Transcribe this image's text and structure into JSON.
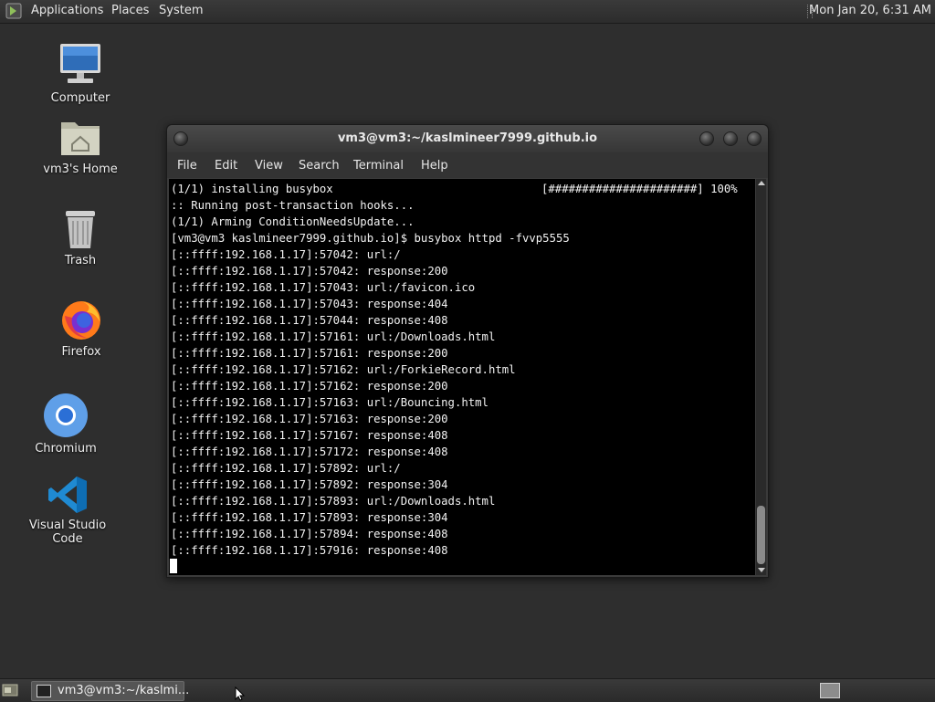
{
  "top_panel": {
    "menus": [
      "Applications",
      "Places",
      "System"
    ],
    "clock": "Mon Jan 20,  6:31 AM"
  },
  "desktop_icons": [
    {
      "label": "Computer",
      "icon": "computer-icon"
    },
    {
      "label": "vm3's Home",
      "icon": "home-folder-icon"
    },
    {
      "label": "Trash",
      "icon": "trash-icon"
    },
    {
      "label": "Firefox",
      "icon": "firefox-icon"
    },
    {
      "label": "Chromium",
      "icon": "chromium-icon"
    },
    {
      "label": "Visual Studio Code",
      "icon": "vscode-icon"
    }
  ],
  "terminal": {
    "title": "vm3@vm3:~/kaslmineer7999.github.io",
    "menu": [
      "File",
      "Edit",
      "View",
      "Search",
      "Terminal",
      "Help"
    ],
    "progress": "[######################] 100%",
    "lines": [
      "(1/1) installing busybox",
      ":: Running post-transaction hooks...",
      "(1/1) Arming ConditionNeedsUpdate...",
      "[vm3@vm3 kaslmineer7999.github.io]$ busybox httpd -fvvp5555",
      "[::ffff:192.168.1.17]:57042: url:/",
      "[::ffff:192.168.1.17]:57042: response:200",
      "[::ffff:192.168.1.17]:57043: url:/favicon.ico",
      "[::ffff:192.168.1.17]:57043: response:404",
      "[::ffff:192.168.1.17]:57044: response:408",
      "[::ffff:192.168.1.17]:57161: url:/Downloads.html",
      "[::ffff:192.168.1.17]:57161: response:200",
      "[::ffff:192.168.1.17]:57162: url:/ForkieRecord.html",
      "[::ffff:192.168.1.17]:57162: response:200",
      "[::ffff:192.168.1.17]:57163: url:/Bouncing.html",
      "[::ffff:192.168.1.17]:57163: response:200",
      "[::ffff:192.168.1.17]:57167: response:408",
      "[::ffff:192.168.1.17]:57172: response:408",
      "[::ffff:192.168.1.17]:57892: url:/",
      "[::ffff:192.168.1.17]:57892: response:304",
      "[::ffff:192.168.1.17]:57893: url:/Downloads.html",
      "[::ffff:192.168.1.17]:57893: response:304",
      "[::ffff:192.168.1.17]:57894: response:408",
      "[::ffff:192.168.1.17]:57916: response:408"
    ]
  },
  "taskbar": {
    "task_label": "vm3@vm3:~/kaslmi..."
  }
}
